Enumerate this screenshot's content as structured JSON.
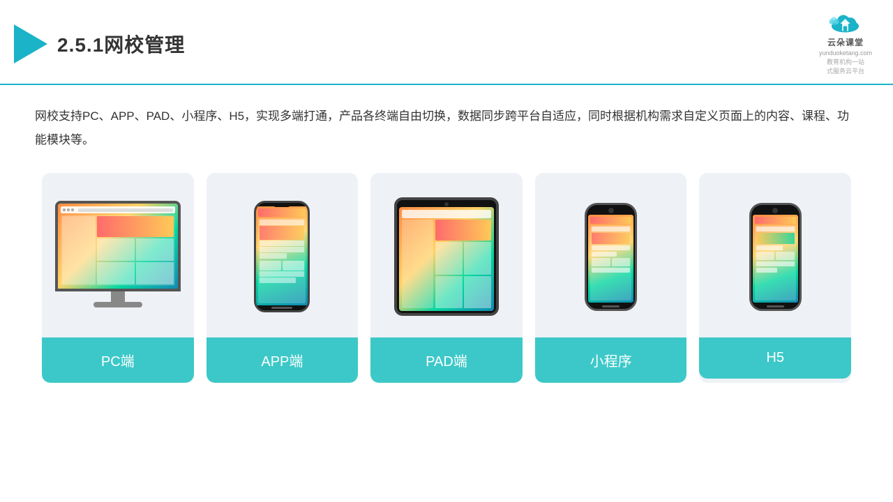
{
  "header": {
    "title": "2.5.1网校管理",
    "brand": {
      "name": "云朵课堂",
      "url": "yunduoketang.com",
      "slogan": "教育机构一站\n式服务云平台"
    }
  },
  "description": "网校支持PC、APP、PAD、小程序、H5，实现多端打通，产品各终端自由切换，数据同步跨平台自适应，同时根据机构需求自定义页面上的内容、课程、功能模块等。",
  "devices": [
    {
      "id": "pc",
      "label": "PC端",
      "type": "pc"
    },
    {
      "id": "app",
      "label": "APP端",
      "type": "phone"
    },
    {
      "id": "pad",
      "label": "PAD端",
      "type": "tablet"
    },
    {
      "id": "mini",
      "label": "小程序",
      "type": "miniphone"
    },
    {
      "id": "h5",
      "label": "H5",
      "type": "miniphone2"
    }
  ],
  "colors": {
    "accent": "#1ab3c8",
    "card_bg": "#eef2f6",
    "label_bg": "#3cc8c8"
  }
}
